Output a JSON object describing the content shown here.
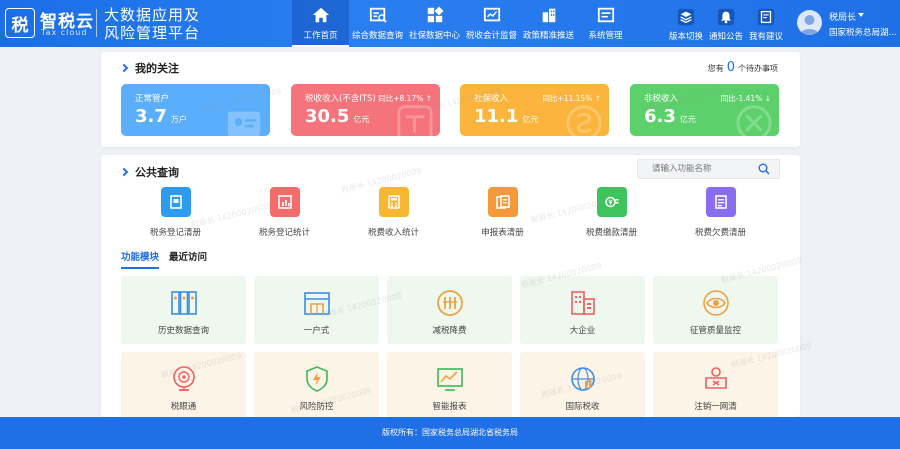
{
  "brand": {
    "logo_char": "税",
    "name": "智税云",
    "sub": "Tax cloud",
    "platform_line1": "大数据应用及",
    "platform_line2": "风险管理平台"
  },
  "nav": [
    {
      "label": "工作首页",
      "icon": "home-icon",
      "active": true
    },
    {
      "label": "综合数据查询",
      "icon": "data-query-icon",
      "active": false
    },
    {
      "label": "社保数据中心",
      "icon": "blocks-icon",
      "active": false
    },
    {
      "label": "税收会计监督",
      "icon": "monitor-icon",
      "active": false
    },
    {
      "label": "政策精准推送",
      "icon": "building-icon",
      "active": false
    },
    {
      "label": "系统管理",
      "icon": "settings-doc-icon",
      "active": false
    }
  ],
  "tools": [
    {
      "label": "版本切换",
      "icon": "layers-icon"
    },
    {
      "label": "通知公告",
      "icon": "bell-icon"
    },
    {
      "label": "我有建议",
      "icon": "edit-doc-icon"
    }
  ],
  "user": {
    "name": "税局长",
    "org": "国家税务总局湖..."
  },
  "focus": {
    "title": "我的关注",
    "todo_prefix": "您有",
    "todo_count": "0",
    "todo_suffix": "个待办事项",
    "stats": [
      {
        "label": "正常管户",
        "value": "3.7",
        "unit": "万户",
        "trend": "",
        "color": "#5aaefb"
      },
      {
        "label": "税收收入(不含ITS)",
        "value": "30.5",
        "unit": "亿元",
        "trend": "同比+8.17% ↑",
        "color": "#f5737a"
      },
      {
        "label": "社保收入",
        "value": "11.1",
        "unit": "亿元",
        "trend": "同比+11.15% ↑",
        "color": "#fcb53c"
      },
      {
        "label": "非税收入",
        "value": "6.3",
        "unit": "亿元",
        "trend": "同比-1.41% ↓",
        "color": "#5cd06a"
      }
    ]
  },
  "query": {
    "title": "公共查询",
    "search_placeholder": "请输入功能名称",
    "quick": [
      {
        "label": "税务登记清册",
        "color": "#2d9cf0",
        "icon": "register-icon"
      },
      {
        "label": "税务登记统计",
        "color": "#f36b6b",
        "icon": "chart-doc-icon"
      },
      {
        "label": "税费收入统计",
        "color": "#f7b733",
        "icon": "calculator-icon"
      },
      {
        "label": "申报表清册",
        "color": "#f59a3b",
        "icon": "report-icon"
      },
      {
        "label": "税费缴款清册",
        "color": "#3dc45c",
        "icon": "payment-icon"
      },
      {
        "label": "税费欠费清册",
        "color": "#8a6cf0",
        "icon": "list-icon"
      }
    ],
    "tabs": [
      {
        "label": "功能模块",
        "active": true
      },
      {
        "label": "最近访问",
        "active": false
      }
    ],
    "modules": [
      {
        "label": "历史数据查询",
        "tone": "green",
        "icon": "archive-icon"
      },
      {
        "label": "一户式",
        "tone": "green",
        "icon": "shop-icon"
      },
      {
        "label": "减税降费",
        "tone": "green",
        "icon": "coins-icon"
      },
      {
        "label": "大企业",
        "tone": "green",
        "icon": "enterprise-icon"
      },
      {
        "label": "征管质量监控",
        "tone": "green",
        "icon": "eye-icon"
      },
      {
        "label": "税眼通",
        "tone": "orange",
        "icon": "radar-icon"
      },
      {
        "label": "风险防控",
        "tone": "orange",
        "icon": "shield-icon"
      },
      {
        "label": "智能报表",
        "tone": "orange",
        "icon": "line-chart-icon"
      },
      {
        "label": "国际税收",
        "tone": "orange",
        "icon": "globe-icon"
      },
      {
        "label": "注销一网清",
        "tone": "orange",
        "icon": "cancel-stamp-icon"
      }
    ]
  },
  "footer": {
    "text": "版权所有：国家税务总局湖北省税务局"
  },
  "watermark": "税局长 14200020009"
}
